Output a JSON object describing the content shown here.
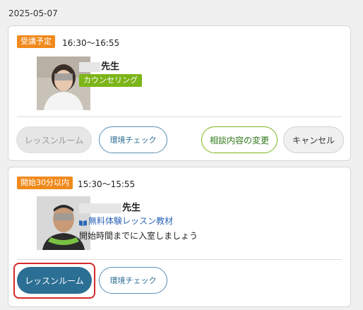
{
  "date": "2025-05-07",
  "lessons": [
    {
      "status_badge": "受講予定",
      "time": "16:30〜16:55",
      "teacher_suffix": "先生",
      "category_tag": "カウンセリング",
      "buttons": {
        "lesson_room": "レッスンルーム",
        "env_check": "環境チェック",
        "change_consult": "相談内容の変更",
        "cancel": "キャンセル"
      }
    },
    {
      "status_badge": "開始30分以内",
      "time": "15:30〜15:55",
      "teacher_suffix": "先生",
      "material_link": "無料体験レッスン教材",
      "note": "開始時間までに入室しましょう",
      "buttons": {
        "lesson_room": "レッスンルーム",
        "env_check": "環境チェック"
      }
    }
  ],
  "colors": {
    "badge_orange": "#f08a1c",
    "tag_green": "#7cb518",
    "primary_blue": "#2c6f94",
    "focus_red": "#d62828"
  },
  "icons": {
    "material": "book-icon"
  }
}
